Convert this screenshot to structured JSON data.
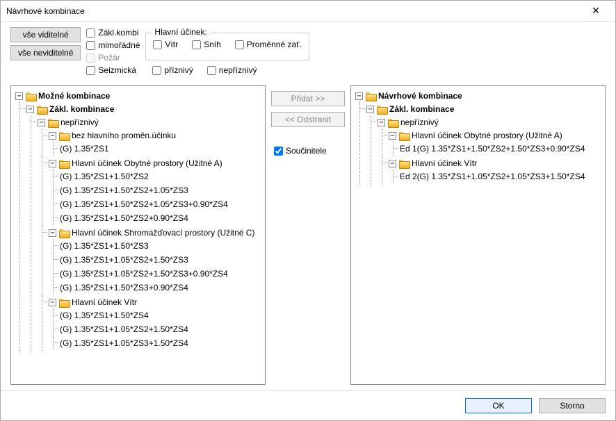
{
  "window": {
    "title": "Návrhové kombinace"
  },
  "buttons": {
    "all_visible": "vše viditelné",
    "all_hidden": "vše neviditelné",
    "add": "Přidat >>",
    "remove": "<< Odstranit",
    "ok": "OK",
    "cancel": "Storno"
  },
  "checkboxes": {
    "zakl_kombi": "Zákl.kombi",
    "mimoradne": "mimořádné",
    "pozar": "Požár",
    "seizmicka": "Seizmická",
    "vitr": "Vítr",
    "snih": "Sníh",
    "promenne": "Proměnné zať.",
    "priznivy": "příznivý",
    "nepriznivy": "nepříznivý",
    "soucinitele": "Součinitele"
  },
  "group_label": "Hlavní účinek:",
  "left_tree": {
    "root": "Možné kombinace",
    "zakl": "Zákl. kombinace",
    "nepriznivy": "nepříznivý",
    "bez_hlav": "bez hlavního proměn.účinku",
    "bez_hlav_items": [
      "(G) 1.35*ZS1"
    ],
    "hu_obytne": "Hlavní účinek Obytné prostory (Užitné A)",
    "hu_obytne_items": [
      "(G) 1.35*ZS1+1.50*ZS2",
      "(G) 1.35*ZS1+1.50*ZS2+1.05*ZS3",
      "(G) 1.35*ZS1+1.50*ZS2+1.05*ZS3+0.90*ZS4",
      "(G) 1.35*ZS1+1.50*ZS2+0.90*ZS4"
    ],
    "hu_shrom": "Hlavní účinek Shromažďovací prostory (Užitné C)",
    "hu_shrom_items": [
      "(G) 1.35*ZS1+1.50*ZS3",
      "(G) 1.35*ZS1+1.05*ZS2+1.50*ZS3",
      "(G) 1.35*ZS1+1.05*ZS2+1.50*ZS3+0.90*ZS4",
      "(G) 1.35*ZS1+1.50*ZS3+0.90*ZS4"
    ],
    "hu_vitr": "Hlavní účinek Vítr",
    "hu_vitr_items": [
      "(G) 1.35*ZS1+1.50*ZS4",
      "(G) 1.35*ZS1+1.05*ZS2+1.50*ZS4",
      "(G) 1.35*ZS1+1.05*ZS3+1.50*ZS4"
    ]
  },
  "right_tree": {
    "root": "Návrhové kombinace",
    "zakl": "Zákl. kombinace",
    "nepriznivy": "nepříznivý",
    "hu_obytne": "Hlavní účinek Obytné prostory (Užitné A)",
    "hu_obytne_items": [
      "Ed 1(G)  1.35*ZS1+1.50*ZS2+1.50*ZS3+0.90*ZS4"
    ],
    "hu_vitr": "Hlavní účinek Vítr",
    "hu_vitr_items": [
      "Ed 2(G)  1.35*ZS1+1.05*ZS2+1.05*ZS3+1.50*ZS4"
    ]
  }
}
